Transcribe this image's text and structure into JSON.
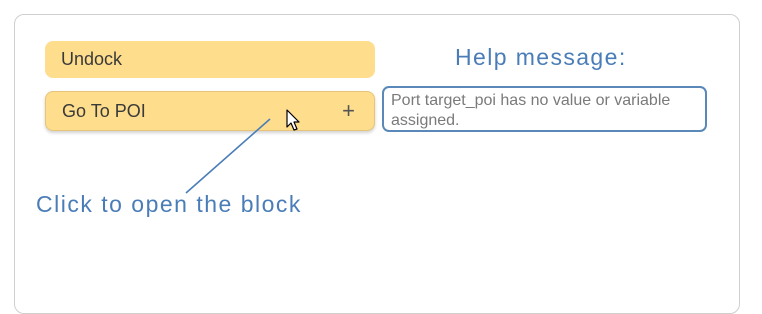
{
  "blocks": [
    {
      "label": "Undock"
    },
    {
      "label": "Go To POI",
      "action_icon": "plus-icon",
      "action_symbol": "+"
    }
  ],
  "help": {
    "title": "Help message:",
    "message": "Port target_poi has no value or variable assigned."
  },
  "annotation": {
    "text": "Click to open the block"
  },
  "colors": {
    "block_fill": "#fedd8c",
    "accent": "#4a7db8",
    "help_border": "#5a88b8"
  },
  "cursor": {
    "icon": "mouse-pointer-icon"
  }
}
